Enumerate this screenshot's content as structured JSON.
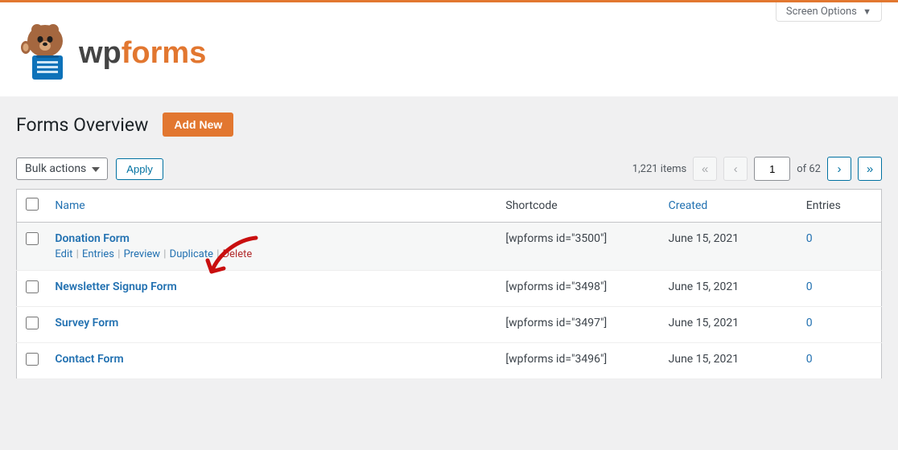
{
  "screen_options": "Screen Options",
  "logo_text": "wpforms",
  "page_title": "Forms Overview",
  "add_new": "Add New",
  "bulk_actions": "Bulk actions",
  "apply": "Apply",
  "pagination": {
    "items_text": "1,221 items",
    "current": "1",
    "of_text": "of 62"
  },
  "columns": {
    "name": "Name",
    "shortcode": "Shortcode",
    "created": "Created",
    "entries": "Entries"
  },
  "row_actions": {
    "edit": "Edit",
    "entries": "Entries",
    "preview": "Preview",
    "duplicate": "Duplicate",
    "delete": "Delete"
  },
  "rows": [
    {
      "name": "Donation Form",
      "shortcode": "[wpforms id=\"3500\"]",
      "created": "June 15, 2021",
      "entries": "0"
    },
    {
      "name": "Newsletter Signup Form",
      "shortcode": "[wpforms id=\"3498\"]",
      "created": "June 15, 2021",
      "entries": "0"
    },
    {
      "name": "Survey Form",
      "shortcode": "[wpforms id=\"3497\"]",
      "created": "June 15, 2021",
      "entries": "0"
    },
    {
      "name": "Contact Form",
      "shortcode": "[wpforms id=\"3496\"]",
      "created": "June 15, 2021",
      "entries": "0"
    }
  ]
}
